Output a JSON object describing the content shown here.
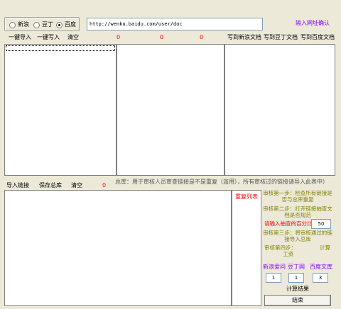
{
  "source": {
    "options": [
      {
        "label": "新浪",
        "selected": false
      },
      {
        "label": "豆丁",
        "selected": false
      },
      {
        "label": "百度",
        "selected": true
      }
    ]
  },
  "url": {
    "value": "http://wenku.baidu.com/user/doc",
    "confirm_label": "输入网址确认"
  },
  "toolbar": {
    "import_one": "一键导入",
    "write_one": "一键写入",
    "clear": "清空",
    "count1": "0",
    "count2": "0",
    "count3": "0",
    "write_sina": "写到新浪文档",
    "write_douding": "写到豆丁文档",
    "write_baidu": "写到百度文档"
  },
  "lower": {
    "import_links": "导入链接",
    "save_library": "保存总库",
    "clear": "清空",
    "count": "0",
    "note": "总库：用于审核人员审查链接是不是重复（滥用），所有审核过的链接请导入此表中）",
    "dup_list": "重复列表"
  },
  "steps": {
    "step1": "审核第一步：检查所有链接是否与总库重复",
    "step2": "审核第二步：打开链接抽查文档是否规范",
    "percent_label": "请输入抽查的百分比",
    "percent_value": "50",
    "step3": "审核第三步：将审核通过的链接导入总库",
    "step4_prefix": "审核第四步：",
    "step4_calc": "计算",
    "step4_salary": "工资"
  },
  "rates": {
    "sina_label": "新浪爱问",
    "douding_label": "豆丁网",
    "baidu_label": "百度文库",
    "sina_value": "1",
    "douding_value": "1",
    "baidu_value": "3"
  },
  "buttons": {
    "calc": "计算结果",
    "finish": "结束"
  },
  "colors": {
    "background": "#ece9d8",
    "count_red": "#ff0000",
    "olive": "#808000",
    "blue": "#0000ff",
    "purple": "#8000ff"
  }
}
